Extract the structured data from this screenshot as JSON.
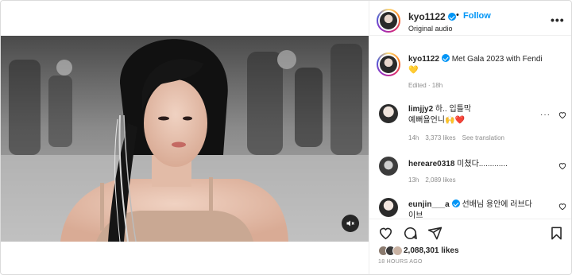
{
  "post": {
    "username": "kyo1122",
    "follow_label": "Follow",
    "audio_label": "Original audio",
    "options_icon": "more-horizontal-icon"
  },
  "caption": {
    "username": "kyo1122",
    "text": "Met Gala 2023 with Fendi",
    "emoji": "💛",
    "edited": "Edited · 18h"
  },
  "comments": [
    {
      "username": "limjjy2",
      "line1": "하.. 입틀막",
      "line2": "예뻐욜언니🙌❤️",
      "time": "14h",
      "likes": "3,373 likes",
      "translate": "See translation"
    },
    {
      "username": "hereare0318",
      "text": "미쳤다.............",
      "time": "13h",
      "likes": "2,089 likes"
    },
    {
      "username": "eunjin___a",
      "text": "선배님 용안에 러브다",
      "text2": "이브"
    }
  ],
  "footer": {
    "likes": "2,088,301 likes",
    "time_ago": "18 HOURS AGO"
  },
  "colors": {
    "accent": "#0095f6",
    "text": "#262626",
    "muted": "#8e8e8e",
    "red_heart": "#ed4956"
  }
}
